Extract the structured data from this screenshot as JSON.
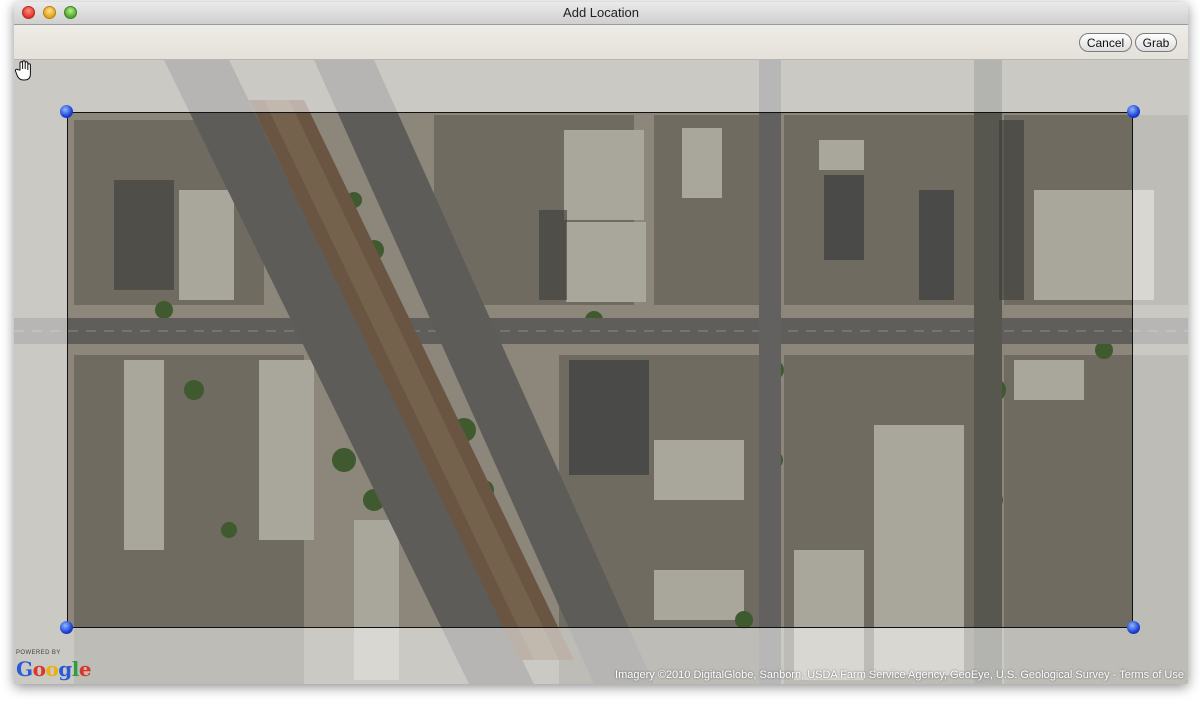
{
  "window": {
    "title": "Add Location"
  },
  "toolbar": {
    "cancel_label": "Cancel",
    "grab_label": "Grab"
  },
  "map": {
    "powered_by": "POWERED BY",
    "logo_letters": [
      "G",
      "o",
      "o",
      "g",
      "l",
      "e"
    ],
    "attribution": "Imagery ©2010 DigitalGlobe, Sanborn, USDA Farm Service Agency, GeoEye, U.S. Geological Survey - Terms of Use"
  },
  "colors": {
    "titlebar": "#d6d6d6",
    "selection_handle": "#1a3fd6",
    "outside_overlay": "#ffffff"
  },
  "icons": [
    "close-icon",
    "minimize-icon",
    "zoom-icon",
    "hand-cursor-icon",
    "google-logo"
  ]
}
